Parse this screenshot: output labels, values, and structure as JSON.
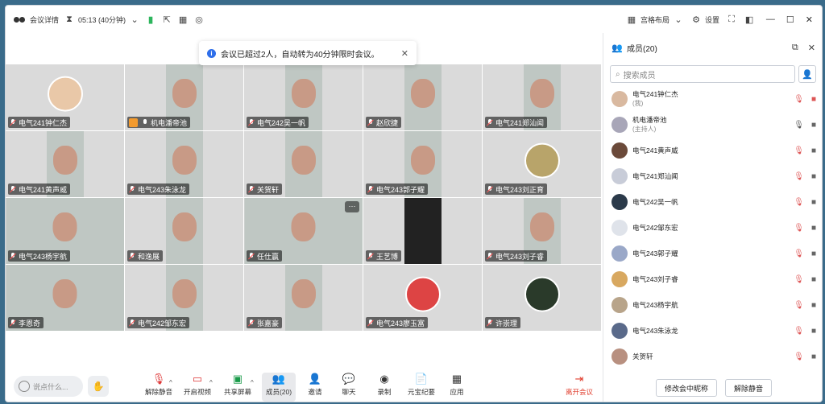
{
  "titlebar": {
    "meeting_info": "会议详情",
    "timer": "05:13 (40分钟)",
    "layout": "宫格布局",
    "settings": "设置"
  },
  "notice": {
    "text": "会议已超过2人，自动转为40分钟限时会议。"
  },
  "tiles": [
    {
      "name": "电气241钟仁杰",
      "kind": "avatar",
      "av": "av1"
    },
    {
      "name": "机电潘帝池",
      "kind": "face",
      "host": true,
      "mic": "on"
    },
    {
      "name": "电气242吴一帆",
      "kind": "face"
    },
    {
      "name": "赵欣捷",
      "kind": "face"
    },
    {
      "name": "电气241郑汕闻",
      "kind": "face"
    },
    {
      "name": "电气241黄声威",
      "kind": "face"
    },
    {
      "name": "电气243朱泳龙",
      "kind": "face"
    },
    {
      "name": "关贺轩",
      "kind": "face"
    },
    {
      "name": "电气243郭子耀",
      "kind": "face"
    },
    {
      "name": "电气243刘正育",
      "kind": "avatar",
      "av": "av2"
    },
    {
      "name": "电气243杨宇航",
      "kind": "wide"
    },
    {
      "name": "和逸展",
      "kind": "face"
    },
    {
      "name": "任仕赢",
      "kind": "wide",
      "more": true
    },
    {
      "name": "王艺博",
      "kind": "dark"
    },
    {
      "name": "电气243刘子睿",
      "kind": "face"
    },
    {
      "name": "李恩奇",
      "kind": "wide"
    },
    {
      "name": "电气242邹东宏",
      "kind": "face"
    },
    {
      "name": "张嘉豪",
      "kind": "face"
    },
    {
      "name": "电气243廖玉富",
      "kind": "avatar",
      "av": "av3"
    },
    {
      "name": "许崇理",
      "kind": "avatar",
      "av": "av4"
    }
  ],
  "toolbar": {
    "speak_placeholder": "说点什么...",
    "buttons": [
      "解除静音",
      "开启视频",
      "共享屏幕",
      "成员(20)",
      "邀请",
      "聊天",
      "录制",
      "元宝纪要",
      "应用"
    ],
    "leave": "离开会议"
  },
  "panel": {
    "title": "成员(20)",
    "search_placeholder": "搜索成员",
    "members": [
      {
        "name": "电气241钟仁杰",
        "sub": "(我)"
      },
      {
        "name": "机电潘帝池",
        "sub": "(主持人)"
      },
      {
        "name": "电气241黄声威",
        "sub": ""
      },
      {
        "name": "电气241郑汕闻",
        "sub": ""
      },
      {
        "name": "电气242吴一帆",
        "sub": ""
      },
      {
        "name": "电气242邹东宏",
        "sub": ""
      },
      {
        "name": "电气243郭子耀",
        "sub": ""
      },
      {
        "name": "电气243刘子睿",
        "sub": ""
      },
      {
        "name": "电气243杨宇航",
        "sub": ""
      },
      {
        "name": "电气243朱泳龙",
        "sub": ""
      },
      {
        "name": "关贺轩",
        "sub": ""
      }
    ],
    "rename_button": "修改会中昵称",
    "unmute_button": "解除静音"
  }
}
